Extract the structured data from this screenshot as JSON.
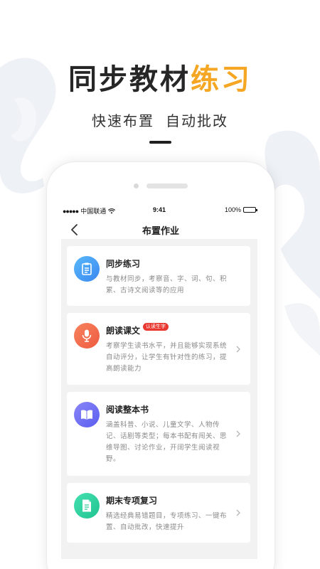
{
  "headline": {
    "part1": "同步教材",
    "part2": "练习"
  },
  "subline": {
    "item1": "快速布置",
    "item2": "自动批改"
  },
  "phone": {
    "status": {
      "carrier": "中国联通",
      "signal_dots": "●●●●●",
      "time": "9:41",
      "battery_text": "100%"
    },
    "nav": {
      "title": "布置作业"
    },
    "cards": [
      {
        "title": "同步练习",
        "desc": "与教材同步，考察音、字、词、句、积累、古诗文阅读等的应用",
        "icon": "clipboard-icon",
        "color": "#4a9ef8",
        "has_arrow": false
      },
      {
        "title": "朗读课文",
        "tag": "认读生字",
        "desc": "考察学生读书水平，并且能够实现系统自动评分，让学生有针对性的练习，提高朗读能力",
        "icon": "microphone-icon",
        "color": "#f26b4c",
        "has_arrow": true
      },
      {
        "title": "阅读整本书",
        "desc": "涵盖科普、小说、儿童文学、人物传记、话剧等类型；每本书配有闯关、思维导图、讨论作业，开阔学生阅读视野。",
        "icon": "book-icon",
        "color": "#6e6ef5",
        "has_arrow": true
      },
      {
        "title": "期末专项复习",
        "desc": "精选经典易错题目，专项练习、一键布置、自动批改，快速提升",
        "icon": "document-icon",
        "color": "#2fd6a0",
        "has_arrow": true
      }
    ]
  },
  "colors": {
    "accent": "#f5a623",
    "title_dark": "#262626",
    "tag_red": "#e8382f",
    "list_bg": "#f2f2f2"
  }
}
